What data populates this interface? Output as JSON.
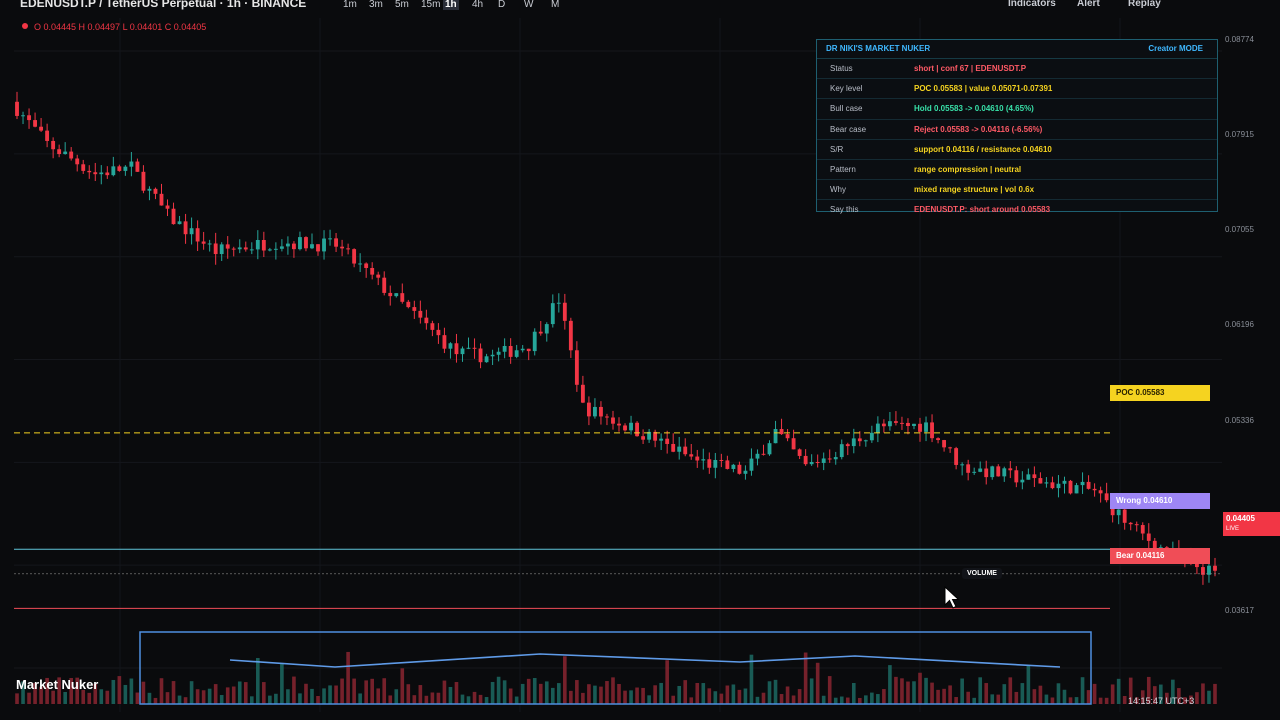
{
  "header": {
    "symbol_title": "EDENUSDT.P / TetherUS Perpetual · 1h · BINANCE",
    "timeframes": [
      "1m",
      "3m",
      "5m",
      "15m",
      "1h",
      "4h",
      "D",
      "W",
      "M"
    ],
    "active_timeframe": "1h",
    "indicators_label": "Indicators",
    "alert_label": "Alert",
    "replay_label": "Replay"
  },
  "ohlc": "O 0.04445 H 0.04497 L 0.04401 C 0.04405",
  "panel": {
    "title": "DR NIKI'S MARKET NUKER",
    "mode": "Creator MODE",
    "rows": [
      {
        "key": "Status",
        "value": "short | conf 67 | EDENUSDT.P",
        "color": "#ff5a66"
      },
      {
        "key": "Key level",
        "value": "POC 0.05583 | value 0.05071-0.07391",
        "color": "#f5d320"
      },
      {
        "key": "Bull case",
        "value": "Hold 0.05583 -> 0.04610 (4.65%)",
        "color": "#38e0a8"
      },
      {
        "key": "Bear case",
        "value": "Reject 0.05583 -> 0.04116 (-6.56%)",
        "color": "#ff5a66"
      },
      {
        "key": "S/R",
        "value": "support 0.04116 / resistance 0.04610",
        "color": "#f5d320"
      },
      {
        "key": "Pattern",
        "value": "range compression | neutral",
        "color": "#f5d320"
      },
      {
        "key": "Why",
        "value": "mixed range structure | vol 0.6x",
        "color": "#f5d320"
      },
      {
        "key": "Say this",
        "value": "EDENUSDT.P: short around 0.05583",
        "color": "#ff5a66"
      }
    ]
  },
  "price_axis": [
    "0.08774",
    "0.07915",
    "0.07055",
    "0.06196",
    "0.05336",
    "0.03617"
  ],
  "levels": {
    "poc_label": "POC 0.05583",
    "wrong_label": "Wrong 0.04610",
    "bear_label": "Bear 0.04116",
    "live_price": "0.04405",
    "live_label": "LIVE",
    "poc_color": "#f5d320",
    "wrong_color": "#5fc4d8",
    "bear_color": "#f04d57"
  },
  "volume_tooltip": "VOLUME",
  "brand": "Market Nuker",
  "clock": "14:15:47 UTC+3",
  "colors": {
    "up": "#26a69a",
    "down": "#f23645",
    "background": "#0a0b0d"
  },
  "chart_data": {
    "type": "candlestick",
    "symbol": "EDENUSDT.P",
    "interval": "1h",
    "ylim": [
      0.0335,
      0.0895
    ],
    "close_path": [
      [
        0,
        0.0835
      ],
      [
        0.03,
        0.08
      ],
      [
        0.07,
        0.0775
      ],
      [
        0.1,
        0.078
      ],
      [
        0.13,
        0.074
      ],
      [
        0.17,
        0.071
      ],
      [
        0.22,
        0.0718
      ],
      [
        0.27,
        0.0715
      ],
      [
        0.32,
        0.067
      ],
      [
        0.37,
        0.0625
      ],
      [
        0.4,
        0.0622
      ],
      [
        0.43,
        0.0632
      ],
      [
        0.455,
        0.067
      ],
      [
        0.475,
        0.058
      ],
      [
        0.52,
        0.056
      ],
      [
        0.57,
        0.0535
      ],
      [
        0.61,
        0.0525
      ],
      [
        0.635,
        0.056
      ],
      [
        0.66,
        0.053
      ],
      [
        0.69,
        0.0545
      ],
      [
        0.72,
        0.0563
      ],
      [
        0.76,
        0.0565
      ],
      [
        0.79,
        0.053
      ],
      [
        0.83,
        0.0522
      ],
      [
        0.87,
        0.0515
      ],
      [
        0.9,
        0.051
      ],
      [
        0.93,
        0.048
      ],
      [
        0.96,
        0.0458
      ],
      [
        1.0,
        0.044
      ]
    ],
    "levels": {
      "poc": 0.05583,
      "wrong": 0.0461,
      "bear": 0.04116,
      "last": 0.04405
    }
  }
}
